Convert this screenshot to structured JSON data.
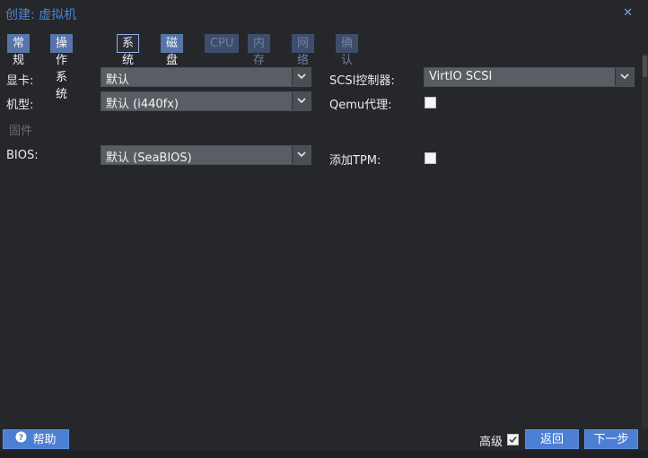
{
  "window": {
    "title": "创建: 虚拟机",
    "close_icon": "close-icon"
  },
  "tabs": [
    {
      "label": "常规",
      "state": "normal"
    },
    {
      "label": "操作系统",
      "state": "normal"
    },
    {
      "label": "系统",
      "state": "active"
    },
    {
      "label": "磁盘",
      "state": "normal"
    },
    {
      "label": "CPU",
      "state": "disabled"
    },
    {
      "label": "内存",
      "state": "disabled"
    },
    {
      "label": "网络",
      "state": "disabled"
    },
    {
      "label": "确认",
      "state": "disabled"
    }
  ],
  "form": {
    "graphics_label": "显卡:",
    "graphics_value": "默认",
    "machine_label": "机型:",
    "machine_value": "默认 (i440fx)",
    "firmware_header": "固件",
    "bios_label": "BIOS:",
    "bios_value": "默认 (SeaBIOS)",
    "scsi_label": "SCSI控制器:",
    "scsi_value": "VirtIO SCSI",
    "qemu_agent_label": "Qemu代理:",
    "qemu_agent_checked": false,
    "tpm_label": "添加TPM:",
    "tpm_checked": false
  },
  "footer": {
    "help_label": "帮助",
    "advanced_label": "高级",
    "advanced_checked": true,
    "back_label": "返回",
    "next_label": "下一步"
  },
  "colors": {
    "background": "#26272b",
    "accent": "#4c7fd4",
    "title": "#4d83d6",
    "field": "#5a5d63"
  }
}
